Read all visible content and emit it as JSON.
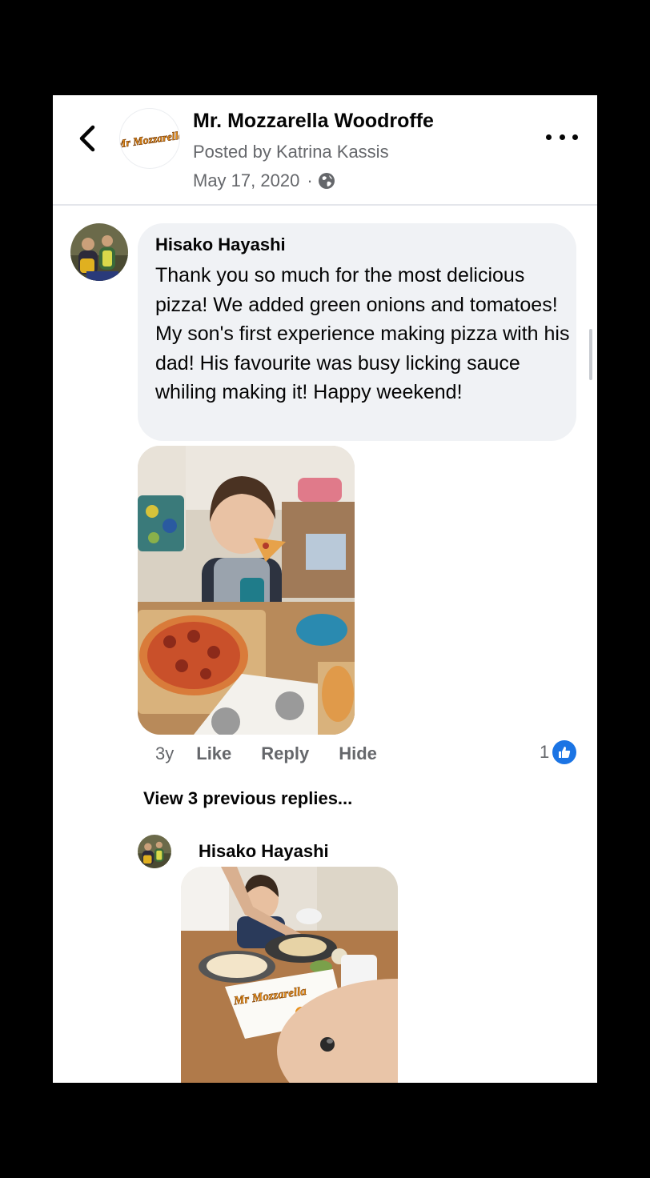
{
  "header": {
    "page_name": "Mr. Mozzarella Woodroffe",
    "posted_by": "Posted by Katrina Kassis",
    "date": "May 17, 2020",
    "separator": "·",
    "logo_text": "Mr Mozzarella"
  },
  "comment": {
    "author": "Hisako Hayashi",
    "text": "Thank you so much for the most delicious pizza! We added green onions and tomatoes! My son's first experience making pizza with his dad! His favourite was busy licking sauce whiling making it! Happy weekend!",
    "age": "3y",
    "actions": {
      "like": "Like",
      "reply": "Reply",
      "hide": "Hide"
    },
    "reaction_count": "1"
  },
  "view_previous": "View 3 previous replies...",
  "reply": {
    "author": "Hisako Hayashi",
    "box_text": "Mr Mozzarella"
  },
  "colors": {
    "primary_text": "#050505",
    "secondary_text": "#65676b",
    "bubble_bg": "#f0f2f5",
    "like_blue": "#1b74e4",
    "brand_orange": "#e8911c"
  },
  "icons": {
    "back": "chevron-left-icon",
    "more": "more-dots-icon",
    "privacy": "globe-icon",
    "reaction": "like-icon"
  }
}
